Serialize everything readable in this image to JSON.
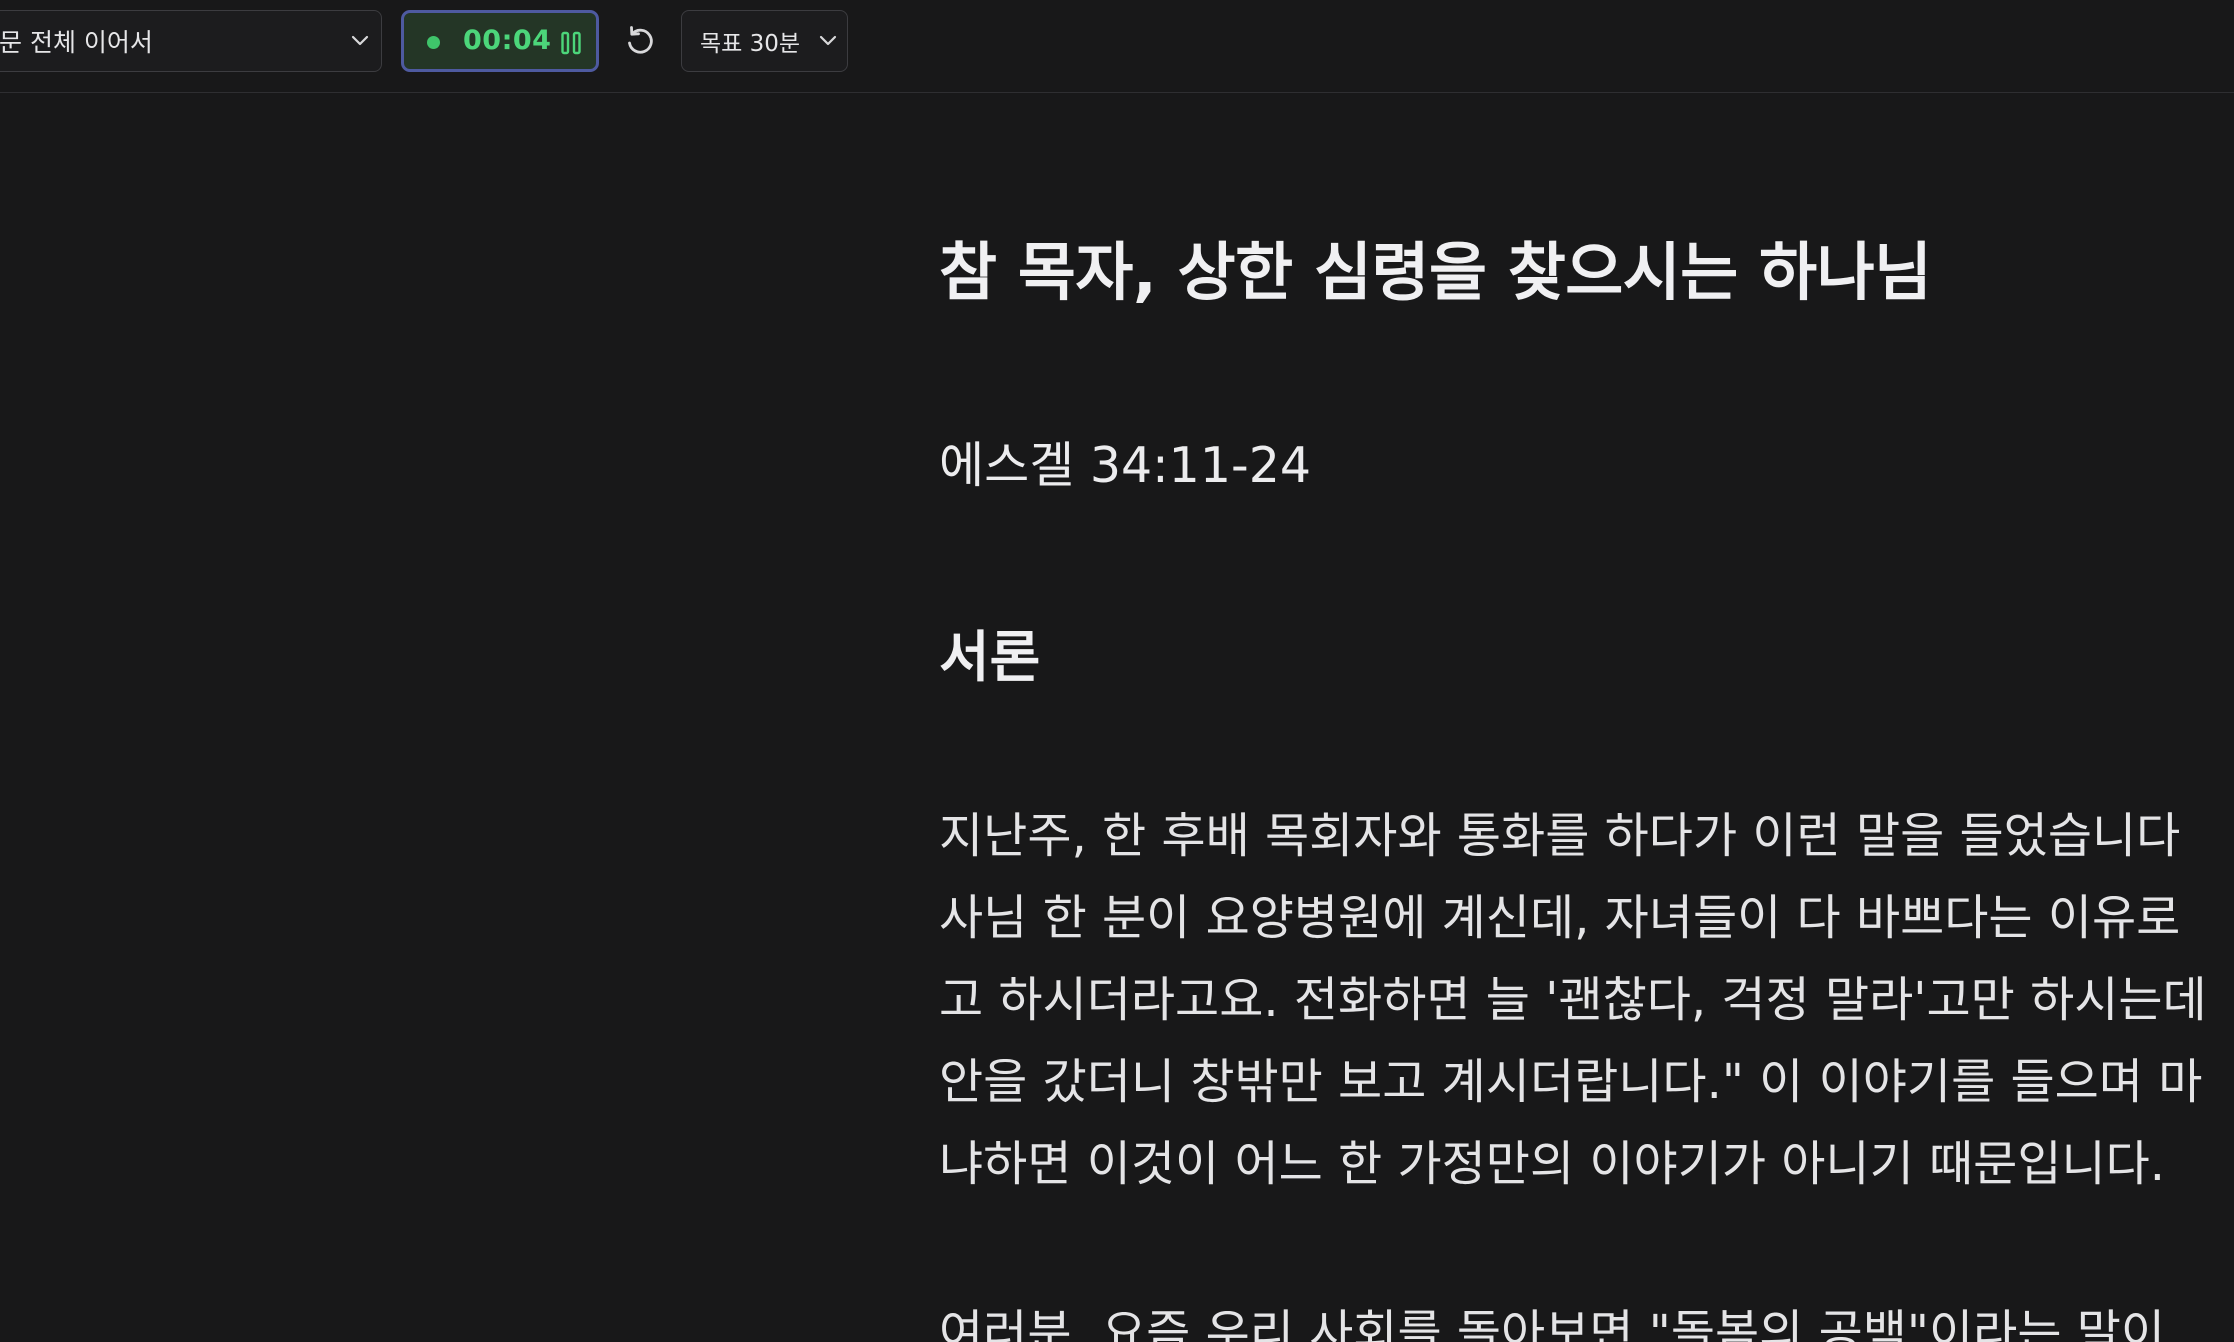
{
  "toolbar": {
    "mode_select_label": "문 전체 이어서",
    "timer_value": "00:04",
    "goal_select_label": "목표 30분"
  },
  "icons": {
    "mode_chevron": "chevron-down-icon",
    "recording_dot": "recording-dot-icon",
    "pause": "pause-icon",
    "reset": "reset-icon",
    "goal_chevron": "chevron-down-icon"
  },
  "colors": {
    "background": "#181819",
    "timer_green": "#4cd67a",
    "timer_border": "#4e5aa0",
    "timer_bg": "#243626"
  },
  "document": {
    "title": "참 목자, 상한 심령을 찾으시는 하나님",
    "passage": "에스겔 34:11-24",
    "section_heading": "서론",
    "paragraph1_lines": [
      "지난주, 한 후배 목회자와 통화를 하다가 이런 말을 들었습니다",
      "사님 한 분이 요양병원에 계신데, 자녀들이 다 바쁘다는 이유로",
      "고 하시더라고요. 전화하면 늘 '괜찮다, 걱정 말라'고만 하시는데",
      "안을 갔더니 창밖만 보고 계시더랍니다.\" 이 이야기를 들으며 마",
      "냐하면 이것이 어느 한 가정만의 이야기가 아니기 때문입니다."
    ],
    "paragraph2_lines": [
      "여러분, 요즘 우리 사회를 돌아보면 \"돌봄의 공백\"이라는 말이"
    ]
  }
}
